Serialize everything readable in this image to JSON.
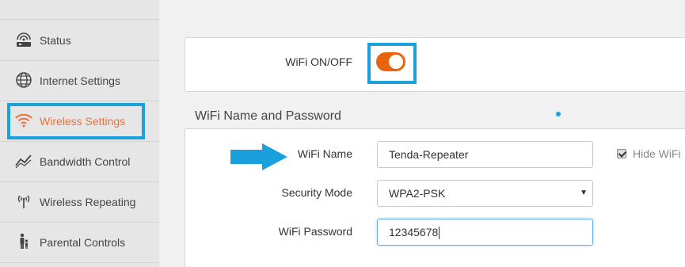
{
  "sidebar": {
    "items": [
      {
        "label": "Status",
        "icon": "router-icon"
      },
      {
        "label": "Internet Settings",
        "icon": "globe-icon"
      },
      {
        "label": "Wireless Settings",
        "icon": "wifi-icon",
        "active": true
      },
      {
        "label": "Bandwidth Control",
        "icon": "bandwidth-chart-icon"
      },
      {
        "label": "Wireless Repeating",
        "icon": "antenna-icon"
      },
      {
        "label": "Parental Controls",
        "icon": "family-icon"
      }
    ]
  },
  "wifi_switch": {
    "label": "WiFi ON/OFF",
    "state": "on",
    "color": "#e8640c"
  },
  "section": {
    "title": "WiFi Name and Password"
  },
  "form": {
    "wifi_name_label": "WiFi Name",
    "wifi_name_value": "Tenda-Repeater",
    "security_mode_label": "Security Mode",
    "security_mode_value": "WPA2-PSK",
    "wifi_password_label": "WiFi Password",
    "wifi_password_value": "12345678",
    "hide_wifi_label": "Hide WiFi",
    "hide_wifi_checked": true
  },
  "colors": {
    "accent": "#e8703a",
    "highlight": "#1aa0dc"
  }
}
